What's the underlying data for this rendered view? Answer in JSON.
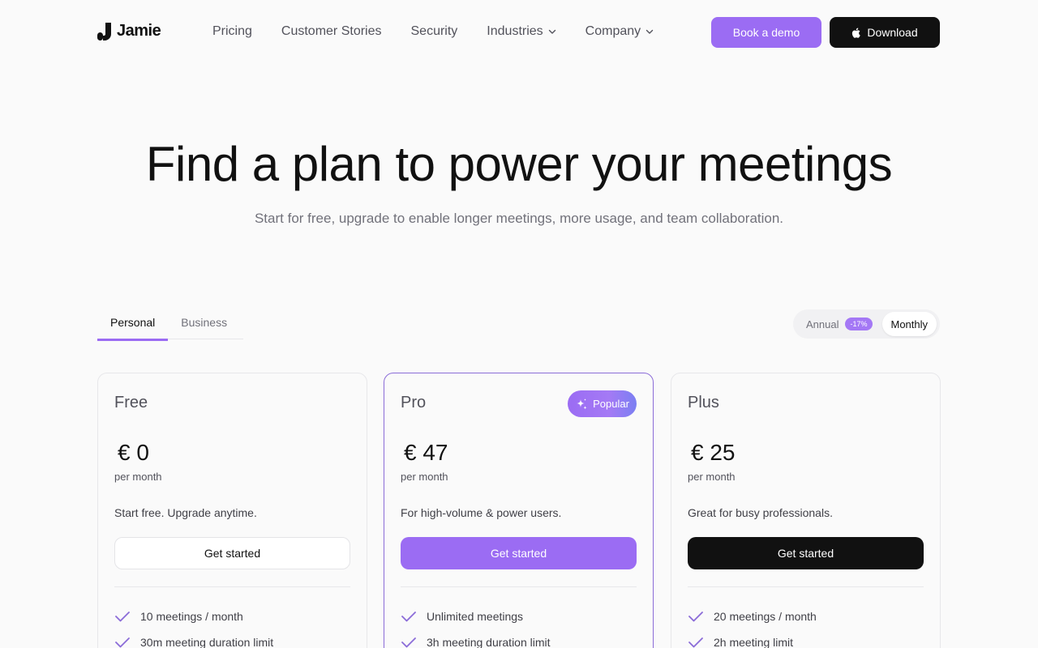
{
  "nav": {
    "logo_text": "Jamie",
    "links": [
      {
        "label": "Pricing"
      },
      {
        "label": "Customer Stories"
      },
      {
        "label": "Security"
      },
      {
        "label": "Industries"
      },
      {
        "label": "Company"
      }
    ],
    "demo_label": "Book a demo",
    "download_label": "Download"
  },
  "hero": {
    "title": "Find a plan to power your meetings",
    "subtitle": "Start for free, upgrade to enable longer meetings, more usage, and team collaboration."
  },
  "tabs": [
    {
      "label": "Personal",
      "active": true
    },
    {
      "label": "Business",
      "active": false
    }
  ],
  "billing": {
    "annual_label": "Annual",
    "discount_badge": "-17%",
    "monthly_label": "Monthly",
    "selected": "Monthly"
  },
  "plans": [
    {
      "name": "Free",
      "price": "€ 0",
      "period": "per month",
      "description": "Start free. Upgrade anytime.",
      "cta": "Get started",
      "features": [
        "10 meetings / month",
        "30m meeting duration limit"
      ]
    },
    {
      "name": "Pro",
      "badge": "Popular",
      "price": "€ 47",
      "period": "per month",
      "description": "For high-volume & power users.",
      "cta": "Get started",
      "features": [
        "Unlimited meetings",
        "3h meeting duration limit"
      ]
    },
    {
      "name": "Plus",
      "price": "€ 25",
      "period": "per month",
      "description": "Great for busy professionals.",
      "cta": "Get started",
      "features": [
        "20 meetings / month",
        "2h meeting limit"
      ]
    }
  ],
  "colors": {
    "accent": "#9b6cf3",
    "dark": "#111111",
    "background": "#fafafa"
  }
}
